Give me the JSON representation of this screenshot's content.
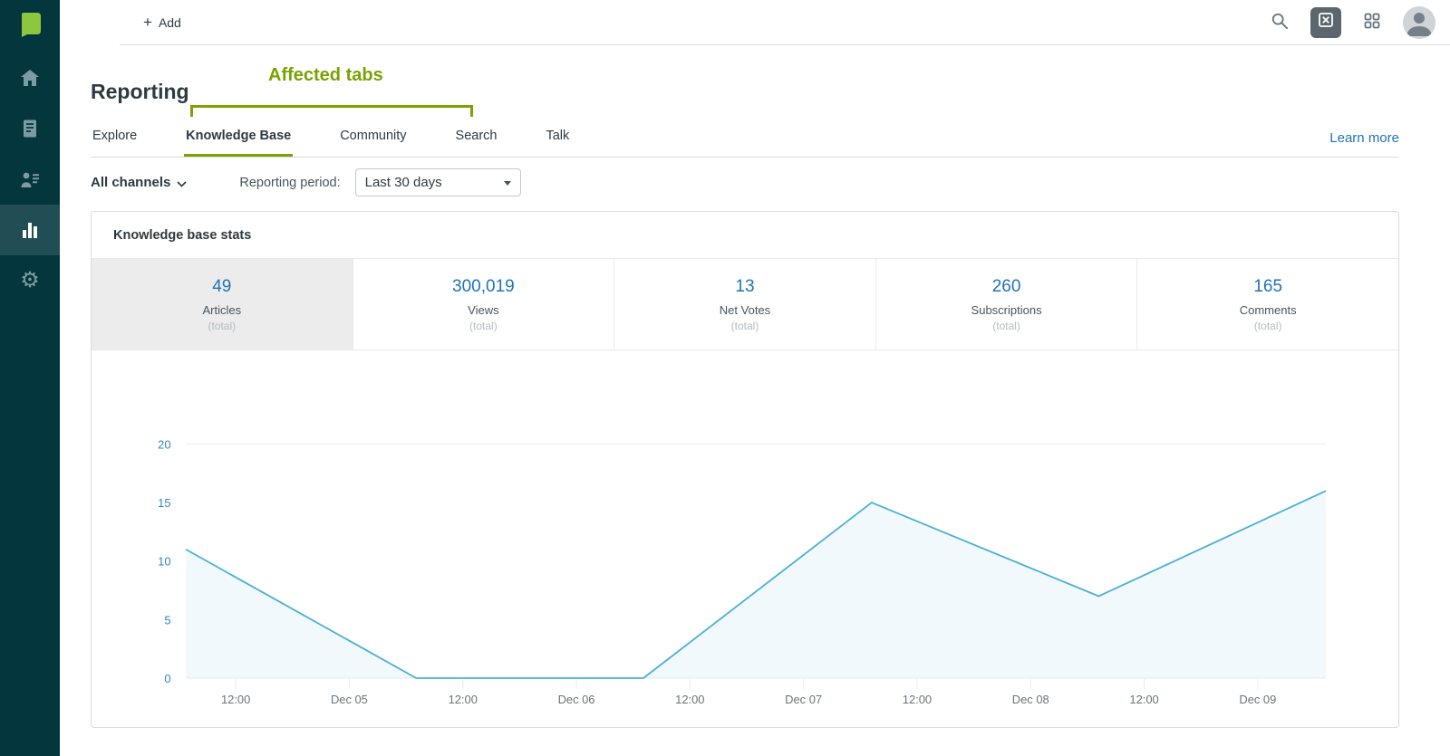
{
  "colors": {
    "accent_green": "#78a300",
    "link_blue": "#1f73b7",
    "stat_blue": "#1f73b7",
    "sidebar_bg": "#03363d"
  },
  "topbar": {
    "add_label": "Add"
  },
  "sidebar": {
    "items": [
      {
        "icon": "home-icon"
      },
      {
        "icon": "guide-book-icon"
      },
      {
        "icon": "customers-icon"
      },
      {
        "icon": "reporting-bar-chart-icon",
        "active": true
      },
      {
        "icon": "settings-gear-icon"
      }
    ]
  },
  "page": {
    "title": "Reporting",
    "annotation": "Affected tabs",
    "learn_more": "Learn more",
    "tabs": [
      {
        "label": "Explore",
        "active": false
      },
      {
        "label": "Knowledge Base",
        "active": true
      },
      {
        "label": "Community",
        "active": false
      },
      {
        "label": "Search",
        "active": false
      },
      {
        "label": "Talk",
        "active": false
      }
    ],
    "filters": {
      "channels": "All channels",
      "period_label": "Reporting period:",
      "period_value": "Last 30 days"
    }
  },
  "card": {
    "title": "Knowledge base stats",
    "stats": [
      {
        "value": "49",
        "label": "Articles",
        "sub": "(total)",
        "selected": true
      },
      {
        "value": "300,019",
        "label": "Views",
        "sub": "(total)",
        "selected": false
      },
      {
        "value": "13",
        "label": "Net Votes",
        "sub": "(total)",
        "selected": false
      },
      {
        "value": "260",
        "label": "Subscriptions",
        "sub": "(total)",
        "selected": false
      },
      {
        "value": "165",
        "label": "Comments",
        "sub": "(total)",
        "selected": false
      }
    ]
  },
  "chart_data": {
    "type": "line",
    "x_unit": "tick-index, one tick = 12 hours",
    "x_tick_labels": [
      "12:00",
      "Dec 05",
      "12:00",
      "Dec 06",
      "12:00",
      "Dec 07",
      "12:00",
      "Dec 08",
      "12:00",
      "Dec 09"
    ],
    "y_ticks": [
      0,
      5,
      10,
      15,
      20
    ],
    "y_gridlines": [
      0,
      20
    ],
    "ylim": [
      0,
      21
    ],
    "legend": "none",
    "series": [
      {
        "name": "Articles",
        "points": [
          {
            "x": -0.44,
            "y": 11
          },
          {
            "x": 1.59,
            "y": 0
          },
          {
            "x": 3.59,
            "y": 0
          },
          {
            "x": 5.6,
            "y": 15
          },
          {
            "x": 7.6,
            "y": 7
          },
          {
            "x": 9.6,
            "y": 16
          }
        ]
      }
    ],
    "colors": {
      "line": "#49b0d6",
      "fill": "rgba(73,176,214,0.07)",
      "y_axis_label": "#2e86c9",
      "x_axis_label": "#68737d",
      "grid": "#e9ebee"
    }
  }
}
